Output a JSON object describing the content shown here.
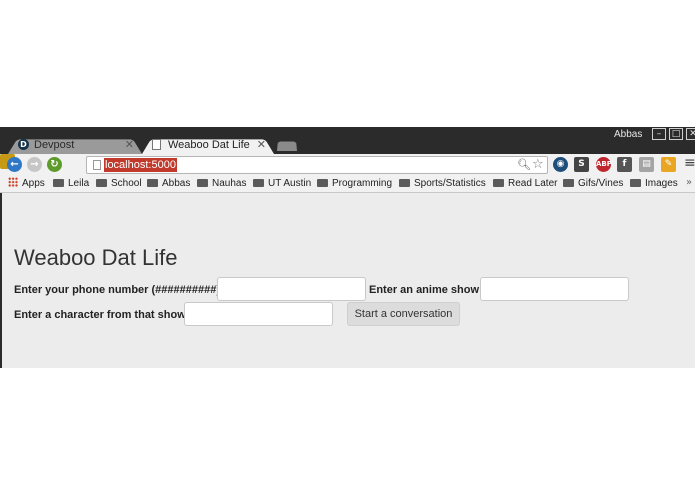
{
  "browser": {
    "tabs": [
      {
        "title": "Devpost",
        "favicon": "D",
        "active": false
      },
      {
        "title": "Weaboo Dat Life",
        "active": true
      }
    ],
    "user": "Abbas",
    "window_controls": {
      "minimize": "–",
      "maximize": "□",
      "close": "✕"
    },
    "url": "localhost:5000",
    "bookmarks": [
      "Apps",
      "Leila",
      "School",
      "Abbas",
      "Nauhas",
      "UT Austin",
      "Programming",
      "Sports/Statistics",
      "Read Later",
      "Gifs/Vines",
      "Images"
    ],
    "bookmarks_overflow": "»",
    "extensions": [
      "S",
      "ABP",
      "f"
    ]
  },
  "page": {
    "title": "Weaboo Dat Life",
    "phone_label": "Enter your phone number (##########):",
    "phone_value": "",
    "anime_label": "Enter an anime show:",
    "anime_value": "",
    "character_label": "Enter a character from that show:",
    "character_value": "",
    "submit_label": "Start a conversation"
  }
}
